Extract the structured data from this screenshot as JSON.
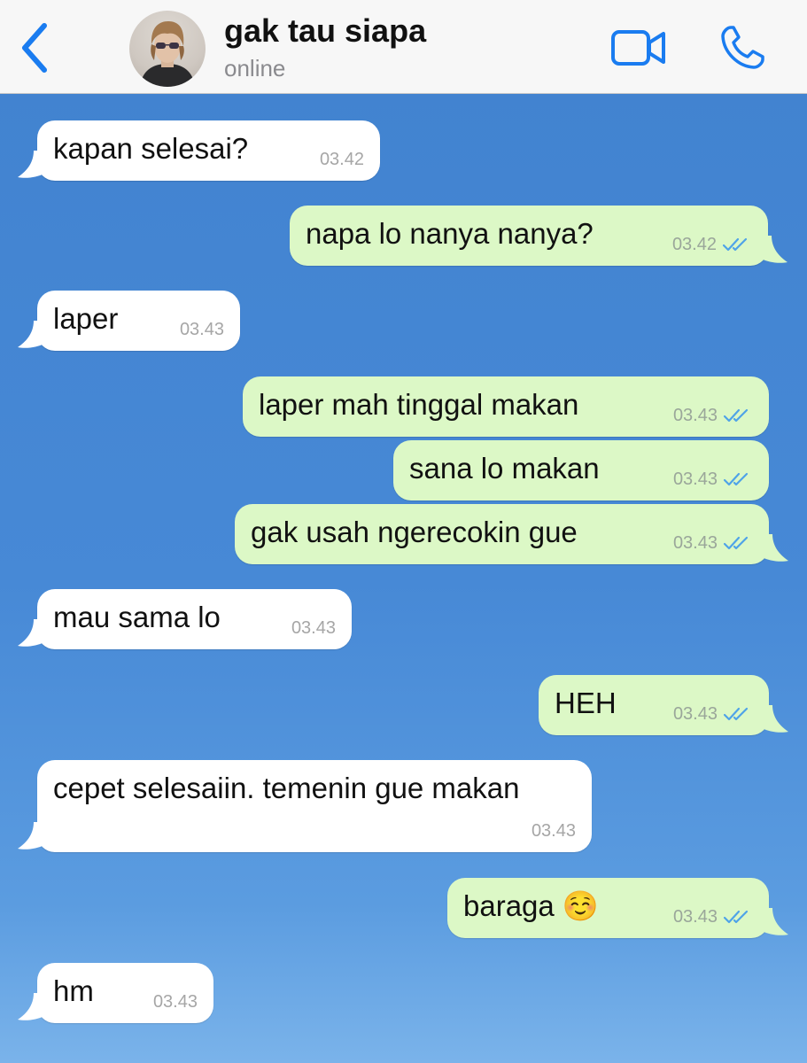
{
  "header": {
    "name": "gak tau siapa",
    "status": "online",
    "back_icon": "chevron-left-icon",
    "video_icon": "video-camera-icon",
    "call_icon": "phone-icon",
    "accent_color": "#1a7cf0"
  },
  "messages": [
    {
      "side": "in",
      "text": "kapan selesai?",
      "time": "03.42"
    },
    {
      "side": "out",
      "text": "napa lo nanya nanya?",
      "time": "03.42",
      "status": "read"
    },
    {
      "side": "in",
      "text": "laper",
      "time": "03.43"
    },
    {
      "side": "out",
      "text": "laper mah tinggal makan",
      "time": "03.43",
      "status": "read"
    },
    {
      "side": "out",
      "text": "sana lo makan",
      "time": "03.43",
      "status": "read"
    },
    {
      "side": "out",
      "text": "gak usah ngerecokin gue",
      "time": "03.43",
      "status": "read"
    },
    {
      "side": "in",
      "text": "mau sama lo",
      "time": "03.43"
    },
    {
      "side": "out",
      "text": "HEH",
      "time": "03.43",
      "status": "read"
    },
    {
      "side": "in",
      "text": "cepet selesaiin. temenin gue makan",
      "time": "03.43"
    },
    {
      "side": "out",
      "text": "baraga ☺️",
      "time": "03.43",
      "status": "read"
    },
    {
      "side": "in",
      "text": "hm",
      "time": "03.43"
    }
  ],
  "colors": {
    "incoming_bubble": "#ffffff",
    "outgoing_bubble": "#dcf8c6",
    "read_ticks": "#4fa3e8",
    "wallpaper": "#4386d3"
  }
}
